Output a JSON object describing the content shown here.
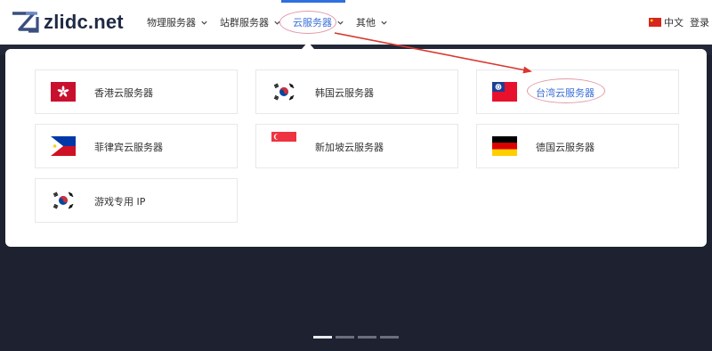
{
  "brand": {
    "name": "zlidc.net",
    "logo_icon": "zl-logo-icon"
  },
  "nav": {
    "items": [
      {
        "label": "物理服务器",
        "icon": "chevron-down-icon",
        "active": false
      },
      {
        "label": "站群服务器",
        "icon": "chevron-down-icon",
        "active": false
      },
      {
        "label": "云服务器",
        "icon": "chevron-down-icon",
        "active": true
      },
      {
        "label": "其他",
        "icon": "chevron-down-icon",
        "active": false
      }
    ]
  },
  "header_right": {
    "language_label": "中文",
    "language_flag": "china-flag-icon",
    "login_label": "登录"
  },
  "cloud_menu": {
    "cards": [
      {
        "label": "香港云服务器",
        "flag": "hong-kong-flag-icon"
      },
      {
        "label": "韩国云服务器",
        "flag": "south-korea-flag-icon"
      },
      {
        "label": "台湾云服务器",
        "flag": "taiwan-flag-icon",
        "highlighted": true
      },
      {
        "label": "菲律宾云服务器",
        "flag": "philippines-flag-icon"
      },
      {
        "label": "新加坡云服务器",
        "flag": "singapore-flag-icon"
      },
      {
        "label": "德国云服务器",
        "flag": "germany-flag-icon"
      },
      {
        "label": "游戏专用 IP",
        "flag": "south-korea-flag-icon"
      }
    ]
  },
  "annotations": {
    "circle_color": "#e29aa6",
    "arrow_color": "#d9382f"
  },
  "carousel": {
    "slide_count": 4,
    "active_index": 0
  },
  "colors": {
    "accent": "#3b6fd8",
    "hero_background": "#1d2130"
  }
}
